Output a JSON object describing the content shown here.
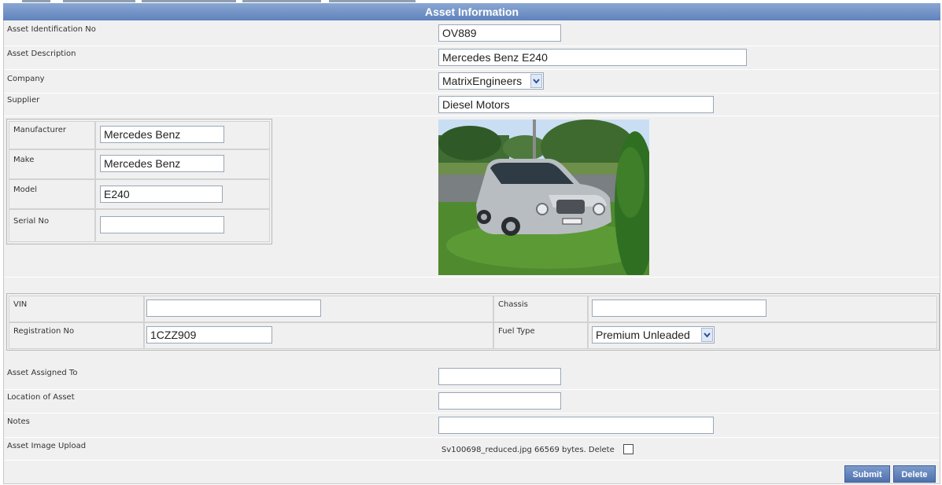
{
  "header": {
    "title": "Asset Information"
  },
  "fields": {
    "asset_id": {
      "label": "Asset Identification No",
      "value": "OV889"
    },
    "description": {
      "label": "Asset Description",
      "value": "Mercedes Benz E240"
    },
    "company": {
      "label": "Company",
      "value": "MatrixEngineers"
    },
    "supplier": {
      "label": "Supplier",
      "value": "Diesel Motors"
    }
  },
  "details": {
    "manufacturer": {
      "label": "Manufacturer",
      "value": "Mercedes Benz"
    },
    "make": {
      "label": "Make",
      "value": "Mercedes Benz"
    },
    "model": {
      "label": "Model",
      "value": "E240"
    },
    "serial": {
      "label": "Serial No",
      "value": ""
    }
  },
  "vehicle": {
    "vin": {
      "label": "VIN",
      "value": ""
    },
    "chassis": {
      "label": "Chassis",
      "value": ""
    },
    "registration": {
      "label": "Registration No",
      "value": "1CZZ909"
    },
    "fuel": {
      "label": "Fuel Type",
      "value": "Premium Unleaded"
    }
  },
  "assignment": {
    "assigned_to": {
      "label": "Asset Assigned To",
      "value": ""
    },
    "location": {
      "label": "Location of Asset",
      "value": ""
    },
    "notes": {
      "label": "Notes",
      "value": ""
    }
  },
  "upload": {
    "label": "Asset Image Upload",
    "file_text": "Sv100698_reduced.jpg 66569 bytes. Delete"
  },
  "buttons": {
    "submit": "Submit",
    "delete": "Delete"
  },
  "colors": {
    "header_bg": "#6f8fc8",
    "button_bg": "#5f7fbd"
  }
}
